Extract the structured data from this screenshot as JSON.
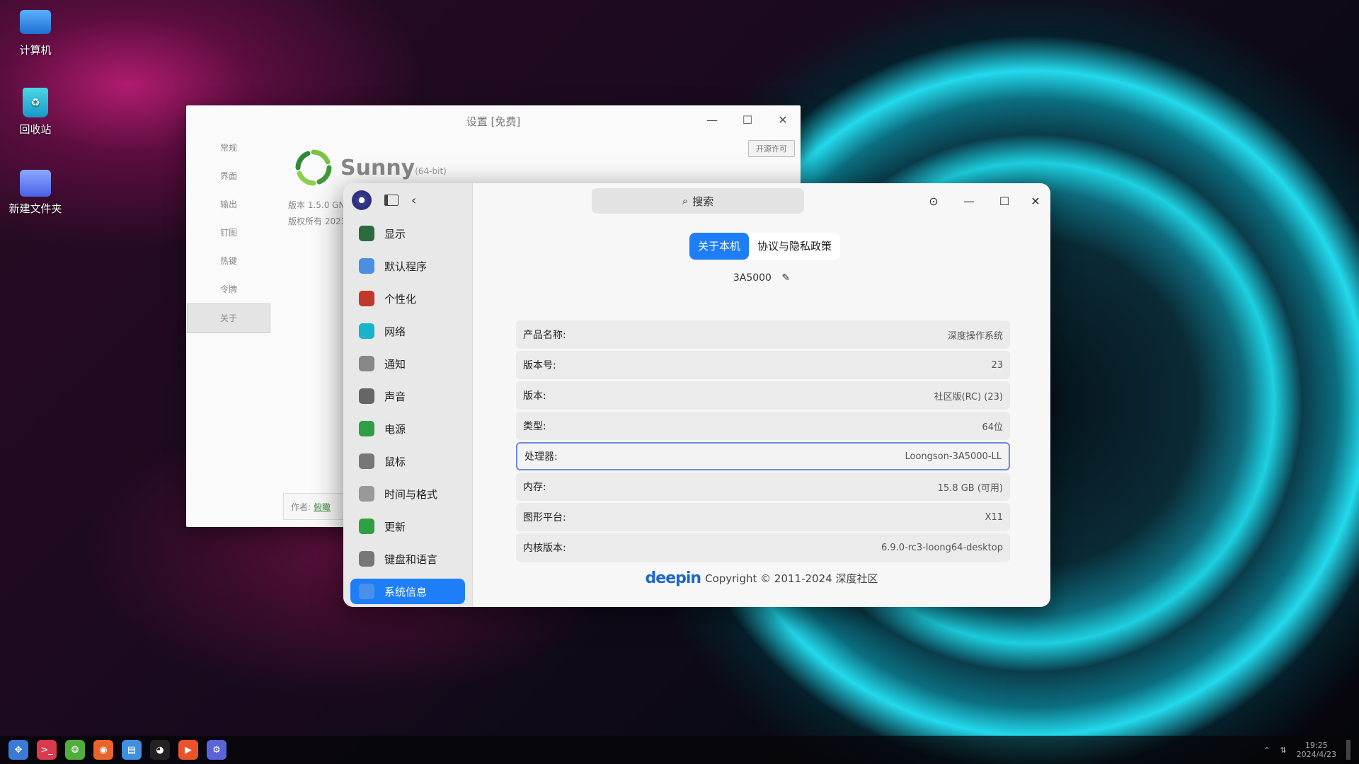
{
  "desktop": {
    "icons": [
      {
        "label": "计算机"
      },
      {
        "label": "回收站"
      },
      {
        "label": "新建文件夹"
      }
    ]
  },
  "sunny": {
    "title": "设置 [免费]",
    "sidebar": [
      "常规",
      "界面",
      "输出",
      "钉图",
      "热键",
      "令牌",
      "关于"
    ],
    "license_button": "开源许可",
    "app_name": "Sunny",
    "bits": "(64-bit)",
    "version": "版本 1.5.0 GN",
    "copyright": "版权所有 2023",
    "author_label": "作者:",
    "author_name": "俯瞰"
  },
  "control_center": {
    "search_placeholder": "搜索",
    "nav": [
      {
        "label": "显示",
        "icon": "display-icon",
        "color": "#2b6b3c"
      },
      {
        "label": "默认程序",
        "icon": "default-apps-icon",
        "color": "#4a90e2"
      },
      {
        "label": "个性化",
        "icon": "personalization-icon",
        "color": "#c0392b"
      },
      {
        "label": "网络",
        "icon": "network-icon",
        "color": "#18b4c9"
      },
      {
        "label": "通知",
        "icon": "notification-icon",
        "color": "#888888"
      },
      {
        "label": "声音",
        "icon": "sound-icon",
        "color": "#666666"
      },
      {
        "label": "电源",
        "icon": "power-icon",
        "color": "#2ea043"
      },
      {
        "label": "鼠标",
        "icon": "mouse-icon",
        "color": "#777777"
      },
      {
        "label": "时间与格式",
        "icon": "clock-icon",
        "color": "#999999"
      },
      {
        "label": "更新",
        "icon": "update-icon",
        "color": "#2ea043"
      },
      {
        "label": "键盘和语言",
        "icon": "keyboard-icon",
        "color": "#777777"
      },
      {
        "label": "系统信息",
        "icon": "system-info-icon",
        "color": "#4a8fe8"
      }
    ],
    "tabs": [
      "关于本机",
      "协议与隐私政策"
    ],
    "hostname": "3A5000",
    "info": [
      {
        "key": "产品名称:",
        "value": "深度操作系统"
      },
      {
        "key": "版本号:",
        "value": "23"
      },
      {
        "key": "版本:",
        "value": "社区版(RC) (23)"
      },
      {
        "key": "类型:",
        "value": "64位"
      },
      {
        "key": "处理器:",
        "value": "Loongson-3A5000-LL"
      },
      {
        "key": "内存:",
        "value": "15.8 GB (可用)"
      },
      {
        "key": "图形平台:",
        "value": "X11"
      },
      {
        "key": "内核版本:",
        "value": "6.9.0-rc3-loong64-desktop"
      }
    ],
    "brand": "deepin",
    "copyright": "Copyright © 2011-2024 深度社区"
  },
  "taskbar": {
    "apps": [
      "launcher-icon",
      "terminal-icon",
      "sunny-icon",
      "firefox-icon",
      "file-manager-icon",
      "qq-icon",
      "wps-icon",
      "settings-icon"
    ],
    "clock_time": "19:25",
    "clock_date": "2024/4/23"
  },
  "colors": {
    "accent": "#1e7ef7",
    "selection_border": "#6d8ad8"
  }
}
